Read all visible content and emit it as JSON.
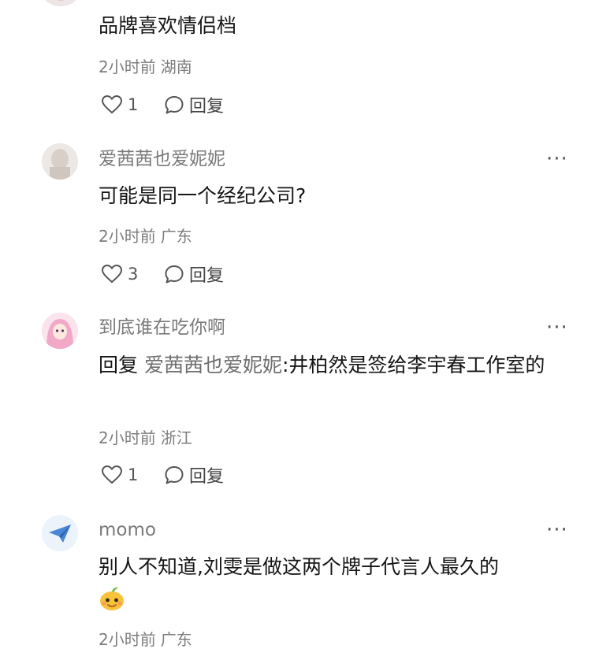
{
  "comments": [
    {
      "text": "品牌喜欢情侣档",
      "time": "2小时前",
      "location": "湖南",
      "likes": "1",
      "reply_label": "回复"
    },
    {
      "username": "爱茜茜也爱妮妮",
      "text": "可能是同一个经纪公司?",
      "time": "2小时前",
      "location": "广东",
      "likes": "3",
      "reply_label": "回复"
    },
    {
      "username": "到底谁在吃你啊",
      "reply_prefix": "回复",
      "reply_target": "爱茜茜也爱妮妮",
      "text": ":井柏然是签给李宇春工作室的",
      "time": "2小时前",
      "location": "浙江",
      "likes": "1",
      "reply_label": "回复"
    },
    {
      "username": "momo",
      "text": "别人不知道,刘雯是做这两个牌子代言人最久的",
      "emoji": "mango-face-emoji",
      "time": "2小时前",
      "location": "广东"
    }
  ],
  "more_icon": "···",
  "icons": {
    "like": "heart-outline-icon",
    "reply": "speech-bubble-icon",
    "more": "more-dots-icon"
  },
  "colors": {
    "username": "#7a7a7a",
    "meta": "#7d7d7d",
    "text": "#161616"
  }
}
